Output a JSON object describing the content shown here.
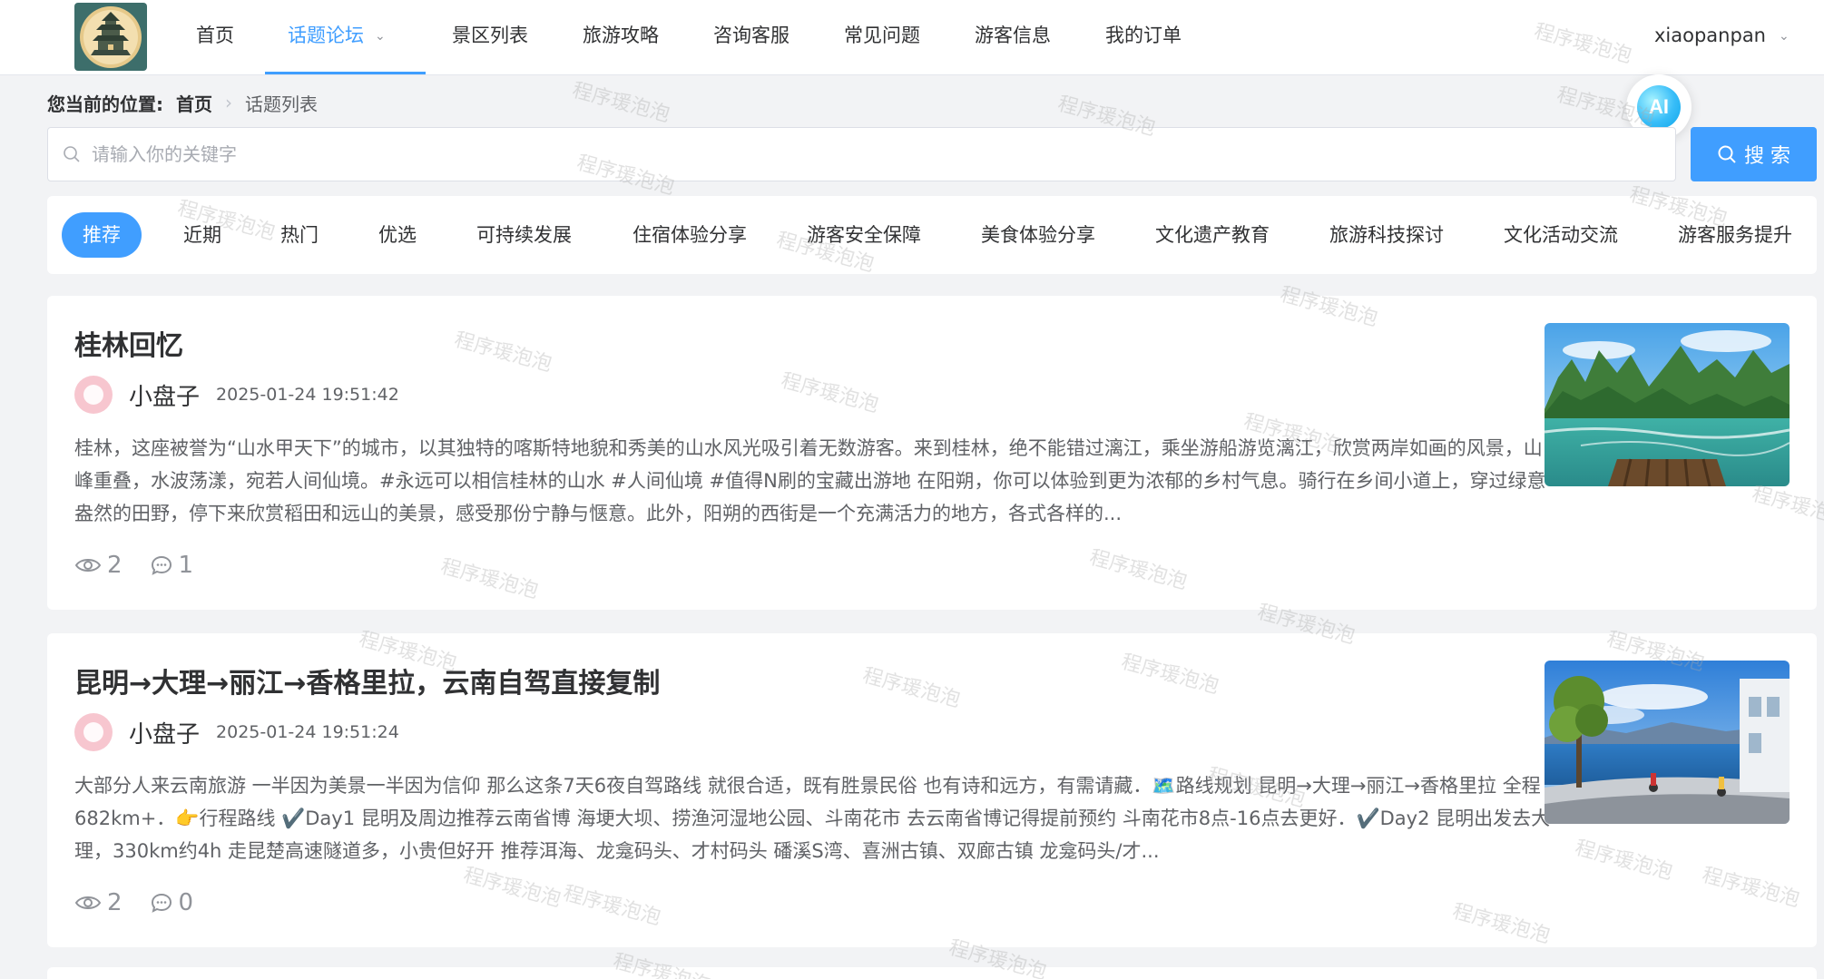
{
  "nav": {
    "items": [
      {
        "label": "首页"
      },
      {
        "label": "话题论坛"
      },
      {
        "label": "景区列表"
      },
      {
        "label": "旅游攻略"
      },
      {
        "label": "咨询客服"
      },
      {
        "label": "常见问题"
      },
      {
        "label": "游客信息"
      },
      {
        "label": "我的订单"
      }
    ],
    "username": "xiaopanpan",
    "active_color": "#409eff"
  },
  "breadcrumb": {
    "prefix": "您当前的位置:",
    "home": "首页",
    "current": "话题列表"
  },
  "ai_badge": "AI",
  "search": {
    "placeholder": "请输入你的关键字",
    "value": "",
    "button_label": "搜 索"
  },
  "categories": [
    "推荐",
    "近期",
    "热门",
    "优选",
    "可持续发展",
    "住宿体验分享",
    "游客安全保障",
    "美食体验分享",
    "文化遗产教育",
    "旅游科技探讨",
    "文化活动交流",
    "游客服务提升"
  ],
  "posts": [
    {
      "title": "桂林回忆",
      "author": "小盘子",
      "date": "2025-01-24 19:51:42",
      "excerpt": "桂林，这座被誉为“山水甲天下”的城市，以其独特的喀斯特地貌和秀美的山水风光吸引着无数游客。来到桂林，绝不能错过漓江，乘坐游船游览漓江，欣赏两岸如画的风景，山峰重叠，水波荡漾，宛若人间仙境。#永远可以相信桂林的山水 #人间仙境 #值得N刷的宝藏出游地 在阳朔，你可以体验到更为浓郁的乡村气息。骑行在乡间小道上，穿过绿意盎然的田野，停下来欣赏稻田和远山的美景，感受那份宁静与惬意。此外，阳朔的西街是一个充满活力的地方，各式各样的...",
      "views": "2",
      "comments": "1",
      "image": "karst-river-photo"
    },
    {
      "title": "昆明→大理→丽江→香格里拉，云南自驾直接复制",
      "author": "小盘子",
      "date": "2025-01-24 19:51:24",
      "excerpt": "大部分人来云南旅游 一半因为美景一半因为信仰 那么这条7天6夜自驾路线 就很合适，既有胜景民俗 也有诗和远方，有需请藏．🗺️路线规划 昆明→大理→丽江→香格里拉 全程682km+．👉行程路线 ✔️Day1 昆明及周边推荐云南省博 海埂大坝、捞渔河湿地公园、斗南花市 去云南省博记得提前预约 斗南花市8点-16点去更好．✔️Day2 昆明出发去大理，330km约4h 走昆楚高速隧道多，小贵但好开 推荐洱海、龙龛码头、才村码头 磻溪S湾、喜洲古镇、双廊古镇 龙龛码头/才...",
      "views": "2",
      "comments": "0",
      "image": "lakeside-road-photo"
    }
  ],
  "watermark": "程序瑗泡泡"
}
